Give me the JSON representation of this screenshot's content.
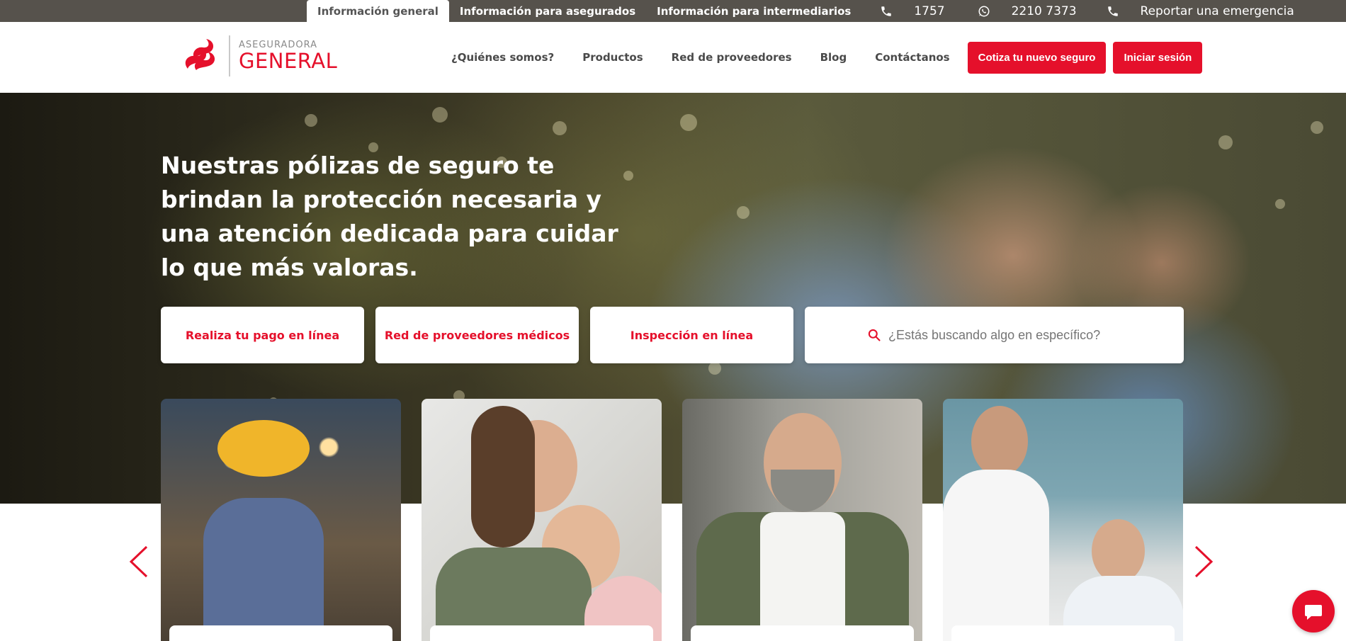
{
  "topbar": {
    "tabs": [
      "Información general",
      "Información para asegurados",
      "Información para intermediarios"
    ],
    "phone": "1757",
    "whatsapp": "2210 7373",
    "emergency": "Reportar una emergencia"
  },
  "logo": {
    "small": "ASEGURADORA",
    "big": "GENERAL"
  },
  "nav": {
    "items": [
      "¿Quiénes somos?",
      "Productos",
      "Red de proveedores",
      "Blog",
      "Contáctanos"
    ],
    "quote_button": "Cotiza tu nuevo seguro",
    "login_button": "Iniciar sesión"
  },
  "hero": {
    "title": "Nuestras pólizas de seguro te brindan la protección necesaria y una atención dedicada para cuidar lo que más valoras."
  },
  "quick_links": [
    "Realiza tu pago en línea",
    "Red de proveedores médicos",
    "Inspección en línea"
  ],
  "search": {
    "placeholder": "¿Estás buscando algo en específico?"
  },
  "colors": {
    "brand_red": "#e5102b",
    "topbar": "#56524c"
  },
  "icons": [
    "phone-icon",
    "whatsapp-icon",
    "phone-emergency-icon",
    "search-icon",
    "chevron-left-icon",
    "chevron-right-icon",
    "chat-icon"
  ]
}
